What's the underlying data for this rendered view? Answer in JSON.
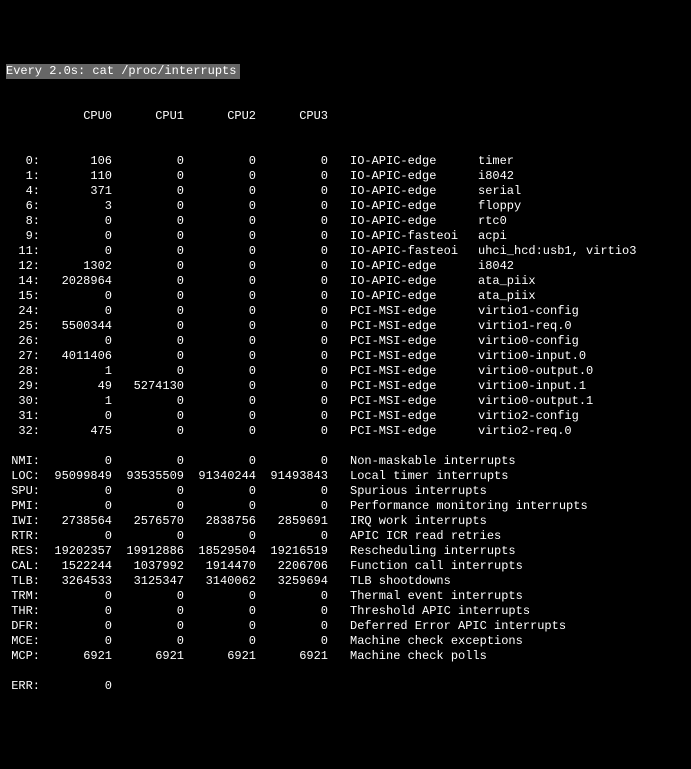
{
  "title": "Every 2.0s: cat /proc/interrupts",
  "cpu_headers": [
    "CPU0",
    "CPU1",
    "CPU2",
    "CPU3"
  ],
  "irq_rows": [
    {
      "id": "0:",
      "c": [
        "106",
        "0",
        "0",
        "0"
      ],
      "type": "IO-APIC-edge",
      "dev": "timer"
    },
    {
      "id": "1:",
      "c": [
        "110",
        "0",
        "0",
        "0"
      ],
      "type": "IO-APIC-edge",
      "dev": "i8042"
    },
    {
      "id": "4:",
      "c": [
        "371",
        "0",
        "0",
        "0"
      ],
      "type": "IO-APIC-edge",
      "dev": "serial"
    },
    {
      "id": "6:",
      "c": [
        "3",
        "0",
        "0",
        "0"
      ],
      "type": "IO-APIC-edge",
      "dev": "floppy"
    },
    {
      "id": "8:",
      "c": [
        "0",
        "0",
        "0",
        "0"
      ],
      "type": "IO-APIC-edge",
      "dev": "rtc0"
    },
    {
      "id": "9:",
      "c": [
        "0",
        "0",
        "0",
        "0"
      ],
      "type": "IO-APIC-fasteoi",
      "dev": "acpi"
    },
    {
      "id": "11:",
      "c": [
        "0",
        "0",
        "0",
        "0"
      ],
      "type": "IO-APIC-fasteoi",
      "dev": "uhci_hcd:usb1, virtio3"
    },
    {
      "id": "12:",
      "c": [
        "1302",
        "0",
        "0",
        "0"
      ],
      "type": "IO-APIC-edge",
      "dev": "i8042"
    },
    {
      "id": "14:",
      "c": [
        "2028964",
        "0",
        "0",
        "0"
      ],
      "type": "IO-APIC-edge",
      "dev": "ata_piix"
    },
    {
      "id": "15:",
      "c": [
        "0",
        "0",
        "0",
        "0"
      ],
      "type": "IO-APIC-edge",
      "dev": "ata_piix"
    },
    {
      "id": "24:",
      "c": [
        "0",
        "0",
        "0",
        "0"
      ],
      "type": "PCI-MSI-edge",
      "dev": "virtio1-config"
    },
    {
      "id": "25:",
      "c": [
        "5500344",
        "0",
        "0",
        "0"
      ],
      "type": "PCI-MSI-edge",
      "dev": "virtio1-req.0"
    },
    {
      "id": "26:",
      "c": [
        "0",
        "0",
        "0",
        "0"
      ],
      "type": "PCI-MSI-edge",
      "dev": "virtio0-config"
    },
    {
      "id": "27:",
      "c": [
        "4011406",
        "0",
        "0",
        "0"
      ],
      "type": "PCI-MSI-edge",
      "dev": "virtio0-input.0"
    },
    {
      "id": "28:",
      "c": [
        "1",
        "0",
        "0",
        "0"
      ],
      "type": "PCI-MSI-edge",
      "dev": "virtio0-output.0"
    },
    {
      "id": "29:",
      "c": [
        "49",
        "5274130",
        "0",
        "0"
      ],
      "type": "PCI-MSI-edge",
      "dev": "virtio0-input.1"
    },
    {
      "id": "30:",
      "c": [
        "1",
        "0",
        "0",
        "0"
      ],
      "type": "PCI-MSI-edge",
      "dev": "virtio0-output.1"
    },
    {
      "id": "31:",
      "c": [
        "0",
        "0",
        "0",
        "0"
      ],
      "type": "PCI-MSI-edge",
      "dev": "virtio2-config"
    },
    {
      "id": "32:",
      "c": [
        "475",
        "0",
        "0",
        "0"
      ],
      "type": "PCI-MSI-edge",
      "dev": "virtio2-req.0"
    }
  ],
  "named_rows": [
    {
      "id": "NMI:",
      "c": [
        "0",
        "0",
        "0",
        "0"
      ],
      "desc": "Non-maskable interrupts"
    },
    {
      "id": "LOC:",
      "c": [
        "95099849",
        "93535509",
        "91340244",
        "91493843"
      ],
      "desc": "Local timer interrupts"
    },
    {
      "id": "SPU:",
      "c": [
        "0",
        "0",
        "0",
        "0"
      ],
      "desc": "Spurious interrupts"
    },
    {
      "id": "PMI:",
      "c": [
        "0",
        "0",
        "0",
        "0"
      ],
      "desc": "Performance monitoring interrupts"
    },
    {
      "id": "IWI:",
      "c": [
        "2738564",
        "2576570",
        "2838756",
        "2859691"
      ],
      "desc": "IRQ work interrupts"
    },
    {
      "id": "RTR:",
      "c": [
        "0",
        "0",
        "0",
        "0"
      ],
      "desc": "APIC ICR read retries"
    },
    {
      "id": "RES:",
      "c": [
        "19202357",
        "19912886",
        "18529504",
        "19216519"
      ],
      "desc": "Rescheduling interrupts"
    },
    {
      "id": "CAL:",
      "c": [
        "1522244",
        "1037992",
        "1914470",
        "2206706"
      ],
      "desc": "Function call interrupts"
    },
    {
      "id": "TLB:",
      "c": [
        "3264533",
        "3125347",
        "3140062",
        "3259694"
      ],
      "desc": "TLB shootdowns"
    },
    {
      "id": "TRM:",
      "c": [
        "0",
        "0",
        "0",
        "0"
      ],
      "desc": "Thermal event interrupts"
    },
    {
      "id": "THR:",
      "c": [
        "0",
        "0",
        "0",
        "0"
      ],
      "desc": "Threshold APIC interrupts"
    },
    {
      "id": "DFR:",
      "c": [
        "0",
        "0",
        "0",
        "0"
      ],
      "desc": "Deferred Error APIC interrupts"
    },
    {
      "id": "MCE:",
      "c": [
        "0",
        "0",
        "0",
        "0"
      ],
      "desc": "Machine check exceptions"
    },
    {
      "id": "MCP:",
      "c": [
        "6921",
        "6921",
        "6921",
        "6921"
      ],
      "desc": "Machine check polls"
    }
  ],
  "tail_rows": [
    {
      "id": "ERR:",
      "c": [
        "0"
      ]
    }
  ]
}
